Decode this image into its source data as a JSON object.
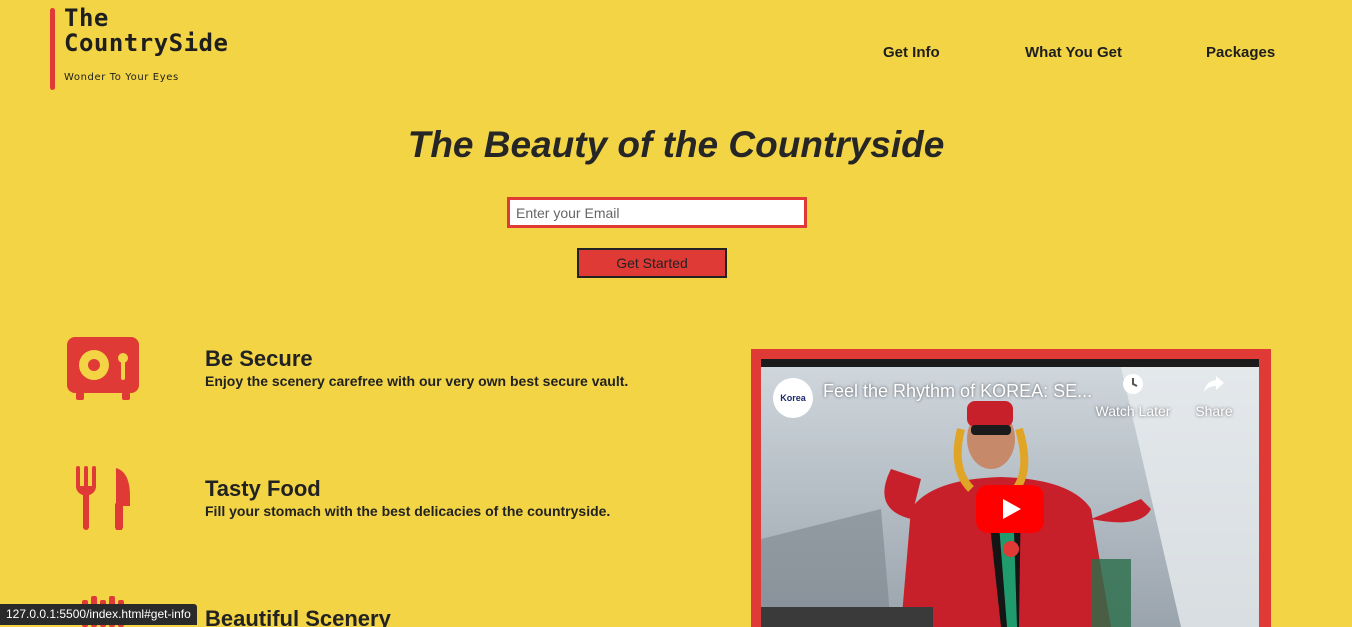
{
  "logo": {
    "title_line1": "The",
    "title_line2": "CountrySide",
    "tagline": "Wonder To Your Eyes"
  },
  "nav": {
    "items": [
      {
        "label": "Get Info"
      },
      {
        "label": "What You Get"
      },
      {
        "label": "Packages"
      }
    ]
  },
  "hero": {
    "title": "The Beauty of the Countryside",
    "email_placeholder": "Enter your Email",
    "button_label": "Get Started"
  },
  "features": [
    {
      "icon": "vault-icon",
      "title": "Be Secure",
      "description": "Enjoy the scenery carefree with our very own best secure vault."
    },
    {
      "icon": "utensils-icon",
      "title": "Tasty Food",
      "description": "Fill your stomach with the best delicacies of the countryside."
    },
    {
      "icon": "scenery-icon",
      "title": "Beautiful Scenery",
      "description": ""
    }
  ],
  "video": {
    "channel_logo_text": "Korea",
    "title": "Feel the Rhythm of KOREA: SE...",
    "watch_later": "Watch Later",
    "share": "Share"
  },
  "status_bar": {
    "url": "127.0.0.1:5500/index.html#get-info"
  },
  "colors": {
    "background": "#f2d445",
    "accent": "#e03a36",
    "text": "#222222"
  }
}
